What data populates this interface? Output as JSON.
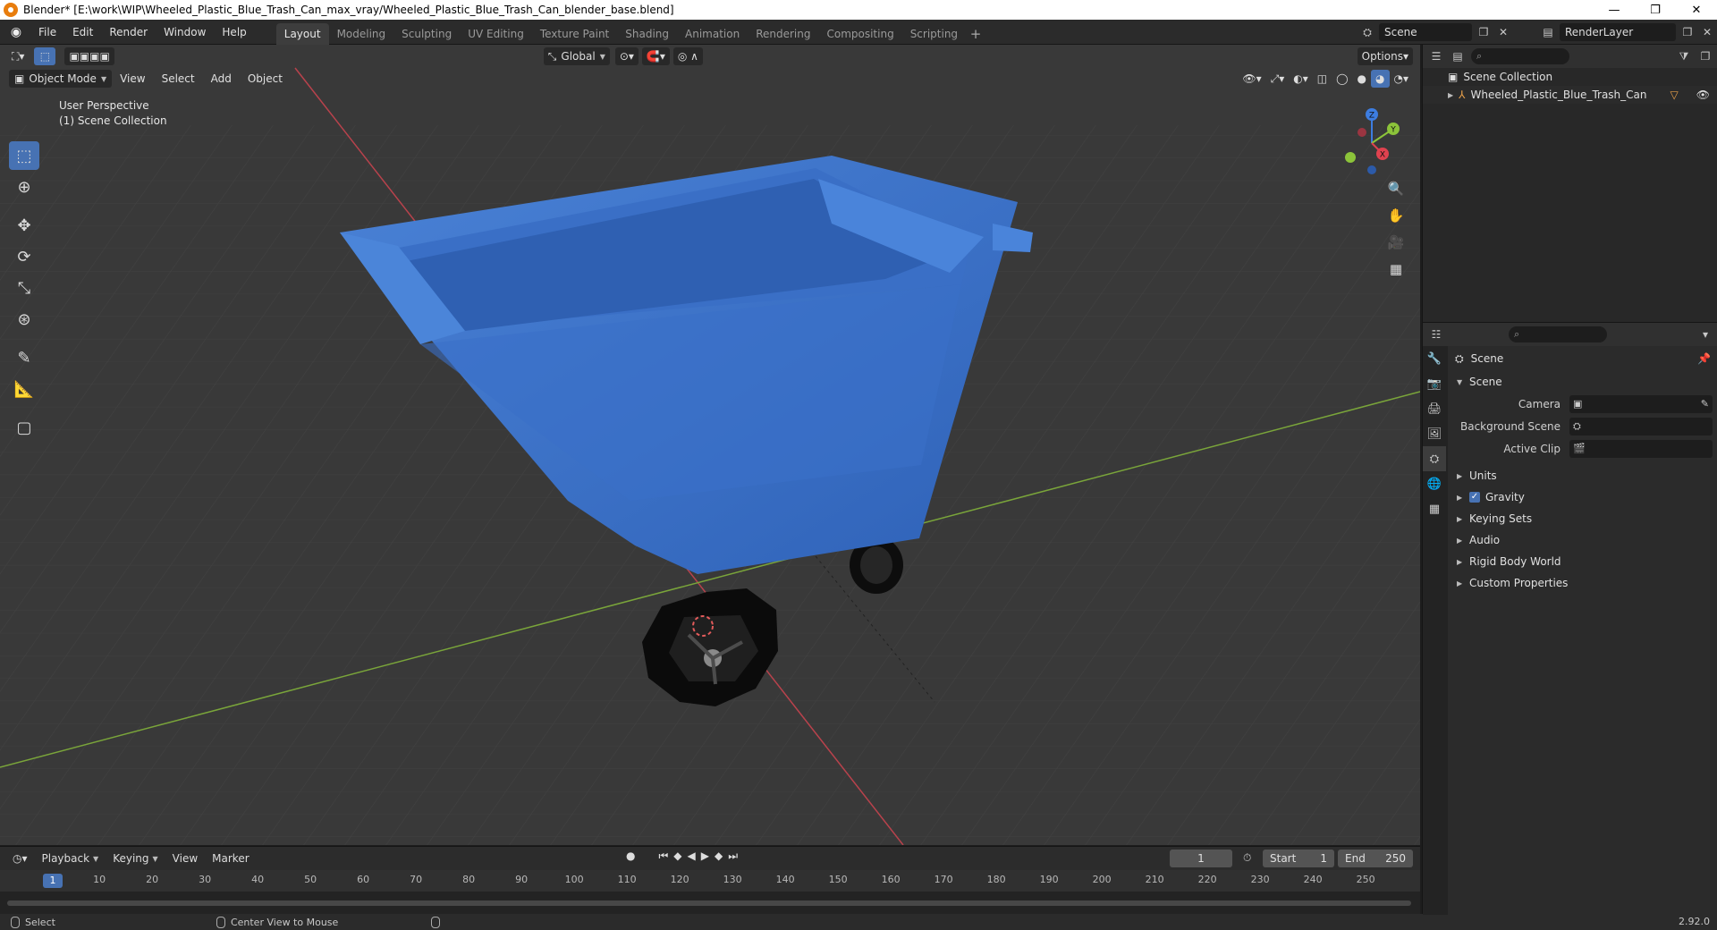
{
  "window": {
    "title": "Blender* [E:\\work\\WIP\\Wheeled_Plastic_Blue_Trash_Can_max_vray/Wheeled_Plastic_Blue_Trash_Can_blender_base.blend]",
    "minimize": "—",
    "maximize": "❐",
    "close": "✕"
  },
  "menu": [
    "File",
    "Edit",
    "Render",
    "Window",
    "Help"
  ],
  "workspaces": [
    "Layout",
    "Modeling",
    "Sculpting",
    "UV Editing",
    "Texture Paint",
    "Shading",
    "Animation",
    "Rendering",
    "Compositing",
    "Scripting"
  ],
  "active_workspace": "Layout",
  "scene_name": "Scene",
  "render_layer": "RenderLayer",
  "viewport": {
    "mode": "Object Mode",
    "header_menu": [
      "View",
      "Select",
      "Add",
      "Object"
    ],
    "transform_orientation": "Global",
    "options_label": "Options",
    "perspective_label": "User Perspective",
    "collection_label": "(1) Scene Collection",
    "gizmo_axes": {
      "x": "X",
      "y": "Y",
      "z": "Z"
    }
  },
  "colors": {
    "accent": "#4772b3",
    "axis_x": "#e0424f",
    "axis_y": "#8cc43a",
    "axis_z": "#3d7de0",
    "trash_can": "#3a6fc6"
  },
  "timeline": {
    "menu": [
      "Playback",
      "Keying",
      "View",
      "Marker"
    ],
    "current_frame": "1",
    "start_label": "Start",
    "start": "1",
    "end_label": "End",
    "end": "250",
    "ticks": [
      "10",
      "20",
      "30",
      "40",
      "50",
      "60",
      "70",
      "80",
      "90",
      "100",
      "110",
      "120",
      "130",
      "140",
      "150",
      "160",
      "170",
      "180",
      "190",
      "200",
      "210",
      "220",
      "230",
      "240",
      "250"
    ],
    "playhead": "1"
  },
  "status": {
    "left": "Select",
    "middle": "Center View to Mouse",
    "version": "2.92.0"
  },
  "outliner": {
    "root": "Scene Collection",
    "items": [
      "Wheeled_Plastic_Blue_Trash_Can"
    ]
  },
  "properties": {
    "breadcrumb": "Scene",
    "panel": "Scene",
    "rows": [
      {
        "label": "Camera",
        "value": ""
      },
      {
        "label": "Background Scene",
        "value": ""
      },
      {
        "label": "Active Clip",
        "value": ""
      }
    ],
    "sections": [
      "Units",
      "Gravity",
      "Keying Sets",
      "Audio",
      "Rigid Body World",
      "Custom Properties"
    ]
  }
}
